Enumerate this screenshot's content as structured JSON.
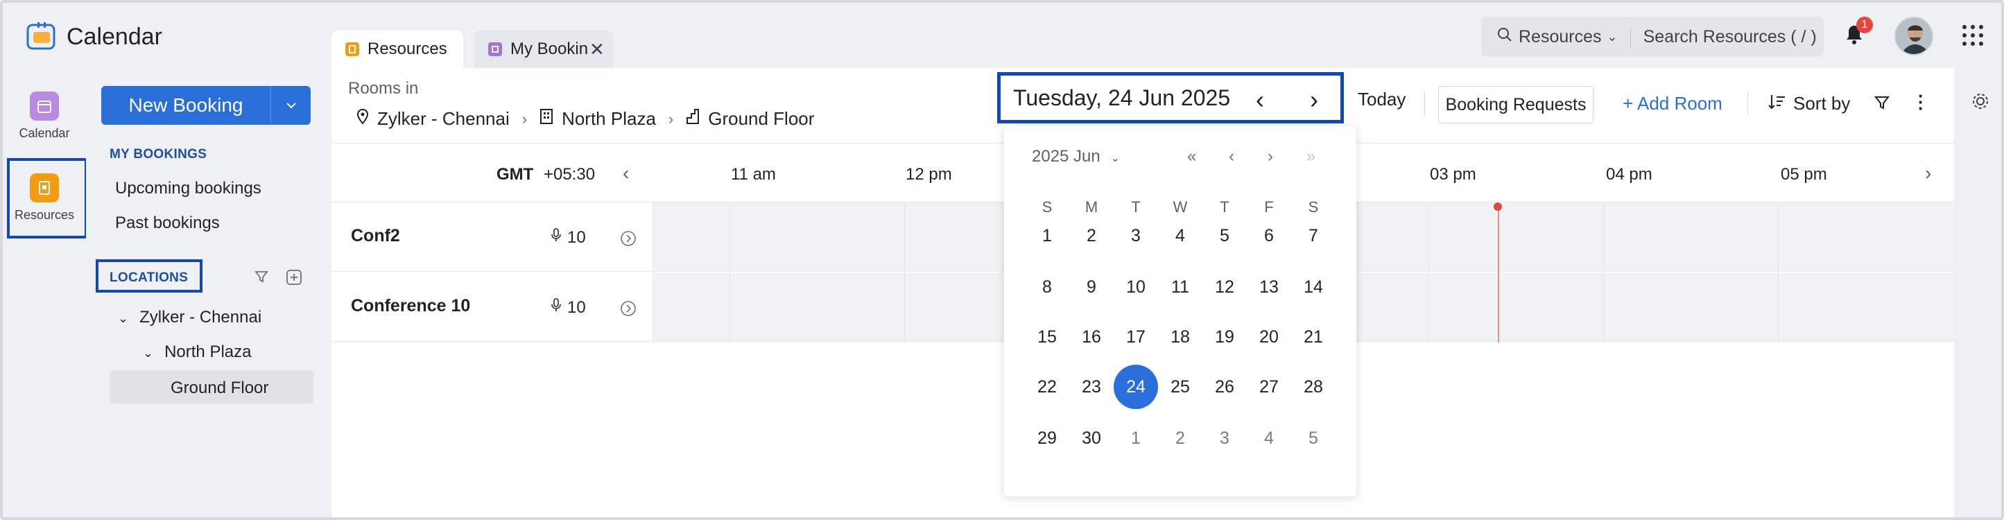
{
  "app": {
    "title": "Calendar"
  },
  "tabs": [
    {
      "label": "Resources",
      "icon": "resources-tab-icon"
    },
    {
      "label": "My Bookin",
      "icon": "bookings-tab-icon"
    }
  ],
  "search": {
    "scope": "Resources",
    "placeholder": "Search Resources ( / )"
  },
  "notifications": {
    "count": "1"
  },
  "rail": [
    {
      "label": "Calendar",
      "icon": "calendar-icon"
    },
    {
      "label": "Resources",
      "icon": "resources-icon"
    }
  ],
  "sidebar": {
    "new_booking": "New Booking",
    "my_bookings_title": "MY BOOKINGS",
    "upcoming": "Upcoming bookings",
    "past": "Past bookings",
    "locations_title": "LOCATIONS",
    "tree": [
      "Zylker - Chennai",
      "North Plaza",
      "Ground Floor"
    ]
  },
  "main": {
    "rooms_in": "Rooms in",
    "breadcrumb": [
      "Zylker - Chennai",
      "North Plaza",
      "Ground Floor"
    ],
    "date_label": "Tuesday, 24 Jun 2025",
    "today": "Today",
    "booking_requests": "Booking Requests",
    "add_room": "+ Add Room",
    "sort_by": "Sort by",
    "gmt": "GMT",
    "gmt_offset": "+05:30",
    "hours": [
      "11 am",
      "12 pm",
      "03 pm",
      "04 pm",
      "05 pm"
    ],
    "rooms": [
      {
        "name": "Conf2",
        "capacity": "10"
      },
      {
        "name": "Conference 10",
        "capacity": "10"
      }
    ]
  },
  "datepicker": {
    "month_label": "2025 Jun",
    "weekdays": [
      "S",
      "M",
      "T",
      "W",
      "T",
      "F",
      "S"
    ],
    "weeks": [
      [
        "1",
        "2",
        "3",
        "4",
        "5",
        "6",
        "7"
      ],
      [
        "8",
        "9",
        "10",
        "11",
        "12",
        "13",
        "14"
      ],
      [
        "15",
        "16",
        "17",
        "18",
        "19",
        "20",
        "21"
      ],
      [
        "22",
        "23",
        "24",
        "25",
        "26",
        "27",
        "28"
      ],
      [
        "29",
        "30",
        "1",
        "2",
        "3",
        "4",
        "5"
      ]
    ],
    "selected": "24"
  },
  "colors": {
    "accent": "#2a6fd9",
    "highlight": "#1148b8",
    "now": "#e8453c"
  }
}
